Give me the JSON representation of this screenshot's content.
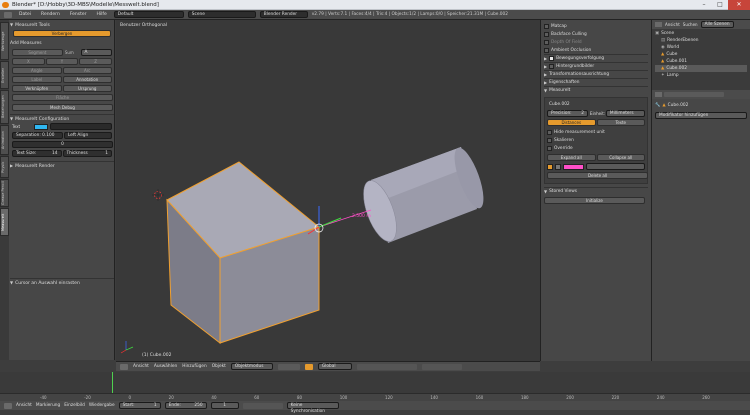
{
  "window": {
    "title": "Blender* [D:\\Hobby\\3D-MBS\\Modelle\\Messwelt.blend]",
    "min": "–",
    "max": "□",
    "close": "✕"
  },
  "menu": [
    "Datei",
    "Rendern",
    "Fenster",
    "Hilfe"
  ],
  "layout": "Default",
  "scene": "Scene",
  "engine": "Blender Render",
  "stats": "v2.79 | Verts:7.1 | Faces:4/4 | Tris:4 | Objects:1/2 | Lamps:0/0 | Speicher:21.31M | Cube.002",
  "left_panel": {
    "tabs": [
      "Werkzeuge",
      "Erstellen",
      "Beziehungen",
      "Animation",
      "Physik",
      "Grease Pencil",
      "Measureit"
    ],
    "tools_header": "MeasureIt Tools",
    "hide_btn": "Verbergen",
    "add_measures": "Add Measures",
    "segment": "Segment",
    "sum": "Sum",
    "sum_val": "A",
    "row1": [
      "X",
      "Y",
      "Z"
    ],
    "row2": [
      "Angle",
      "Arc"
    ],
    "label": "Label",
    "annotation": "Annotation",
    "link": "Verknüpfen",
    "origin": "Ursprung",
    "area": "Fläche",
    "debug": "Mesh Debug",
    "config_header": "MeasureIt Configuration",
    "text_label": "Text",
    "sep_label": "Separation: 0.100",
    "align": "Left Align",
    "zero": "0",
    "text_size": "Text Size:",
    "text_size_val": "14",
    "thickness": "Thickness",
    "thickness_val": "1",
    "render_header": "MeasureIt Render",
    "operator": "Cursor an Auswahl einrasten"
  },
  "viewport": {
    "label": "Benutzer Orthogonal",
    "object": "(1) Cube.002",
    "dist_label": "2.500 m"
  },
  "view_header": {
    "items": [
      "Ansicht",
      "Auswählen",
      "Hinzufügen",
      "Objekt"
    ],
    "mode": "Objektmodus",
    "pivot": "Global"
  },
  "right_panel": {
    "matcap": "Matcap",
    "backface": "Backface Culling",
    "depth": "Depth Of Field",
    "ambient": "Ambient Occlusion",
    "motion": "Bewegungsverfolgung",
    "background": "Hintergrundbilder",
    "transform": "Transformationsausrichtung",
    "properties": "Eigenschaften",
    "measureit": "MeasureIt",
    "object": "Cube.002",
    "precision": "Precision:",
    "prec_val": "2",
    "units": "Einheit:",
    "units_val": "Millimeters",
    "distances": "Distances",
    "texts": "Texte",
    "hide_unit": "Hide measurement unit",
    "scale": "Skalieren",
    "override": "Override",
    "expand": "Expand all",
    "collapse": "Collapse all",
    "delete": "Delete all",
    "stored_views": "Stored Views",
    "init": "Initialize",
    "accent": "#e59a2d",
    "pink": "#ff4fc8"
  },
  "outliner": {
    "tabs": [
      "Ansicht",
      "Suchen",
      "Alle Szenen"
    ],
    "items": [
      "Scene",
      "RenderEbenen",
      "World",
      "Cube",
      "Cube.001",
      "Cube.002",
      "Lamp"
    ]
  },
  "props": {
    "object": "Cube.002",
    "modifier": "Modifikator hinzufügen"
  },
  "timeline": {
    "menu": [
      "Ansicht",
      "Markierung",
      "Einzelbild",
      "Wiedergabe"
    ],
    "start": "Start:",
    "start_val": "1",
    "end": "Ende:",
    "end_val": "250",
    "current": "1",
    "sync": "Keine Synchronisation",
    "ticks": [
      "-40",
      "-20",
      "0",
      "20",
      "40",
      "60",
      "80",
      "100",
      "120",
      "140",
      "160",
      "180",
      "200",
      "220",
      "240",
      "260"
    ]
  }
}
